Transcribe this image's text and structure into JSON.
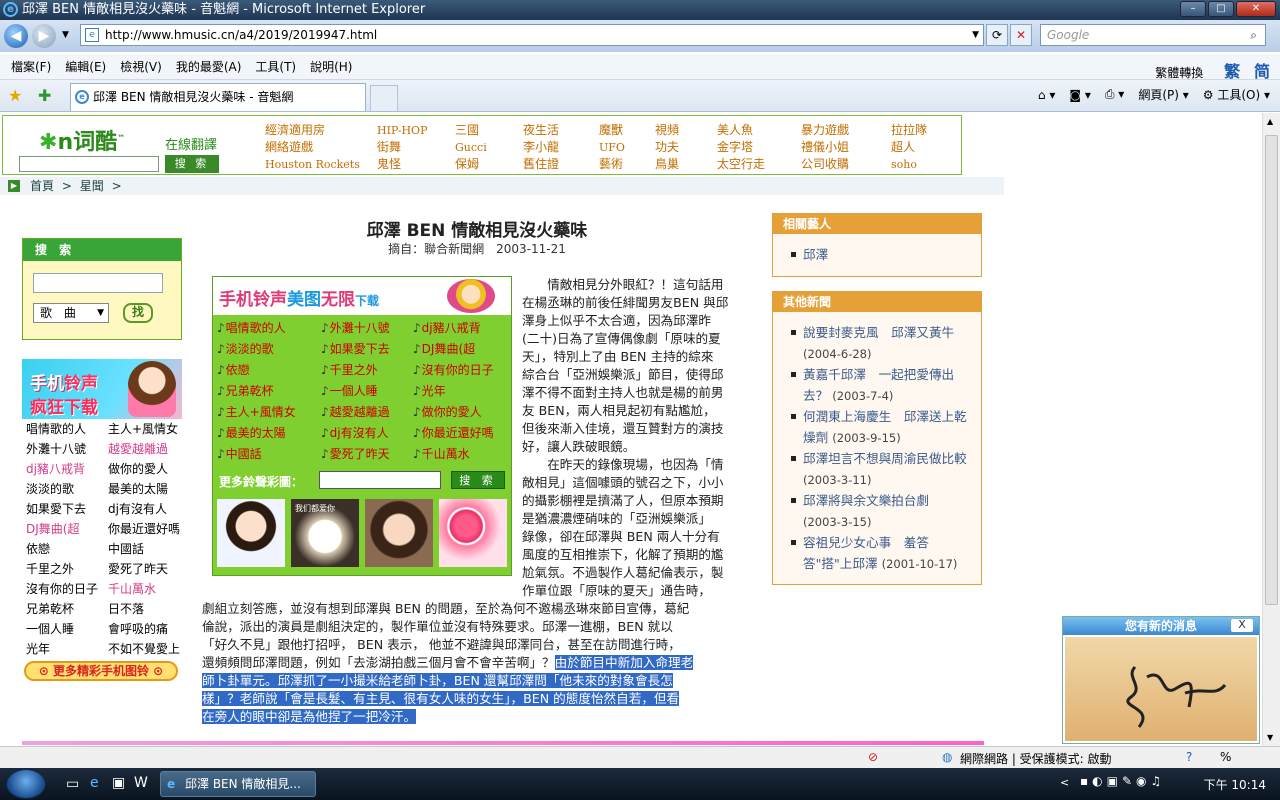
{
  "window": {
    "title": "邱澤 BEN 情敵相見沒火藥味 - 音魁網 - Microsoft Internet Explorer"
  },
  "browser": {
    "url": "http://www.hmusic.cn/a4/2019/2019947.html",
    "search_placeholder": "Google",
    "menu": [
      "檔案(F)",
      "編輯(E)",
      "檢視(V)",
      "我的最愛(A)",
      "工具(T)",
      "說明(H)"
    ],
    "lang_switch": "繁體轉換",
    "lang_trad": "繁",
    "lang_simp": "简",
    "tab_title": "邱澤 BEN 情敵相見沒火藥味 - 音魁網",
    "tools": {
      "page": "網頁(P)",
      "tools": "工具(O)"
    }
  },
  "topad": {
    "logo": "n词酷",
    "translate": "在線翻譯",
    "search_btn": "搜 索",
    "keywords": [
      [
        "經濟適用房",
        "網絡遊戲",
        "Houston Rockets"
      ],
      [
        "HIP-HOP",
        "街舞",
        "鬼怪"
      ],
      [
        "三國",
        "Gucci",
        "保姆"
      ],
      [
        "夜生活",
        "李小龍",
        "舊住證"
      ],
      [
        "魔獸",
        "UFO",
        "藝術"
      ],
      [
        "視頻",
        "功夫",
        "鳥巢"
      ],
      [
        "美人魚",
        "金字塔",
        "太空行走"
      ],
      [
        "暴力遊戲",
        "禮儀小姐",
        "公司收購"
      ],
      [
        "拉拉隊",
        "超人",
        "soho"
      ]
    ]
  },
  "breadcrumb": {
    "home": "首頁",
    "sep1": ">",
    "section": "星聞",
    "sep2": ">"
  },
  "left": {
    "search_title": "搜 索",
    "select_value": "歌 曲",
    "go_btn": "找",
    "banner_line1a": "手机",
    "banner_line1b": "铃声",
    "banner_line2": "疯狂下载",
    "rings_col1": [
      "唱情歌的人",
      "外灘十八號",
      "dj豬八戒背",
      "淡淡的歌",
      "如果愛下去",
      "DJ舞曲(超",
      "依戀",
      "千里之外",
      "沒有你的日子",
      "兄弟乾杯",
      "一個人睡",
      "光年"
    ],
    "rings_col2": [
      "主人+風情女",
      "越愛越離過",
      "做你的愛人",
      "最美的太陽",
      "dj有沒有人",
      "你最近還好嗎",
      "中國話",
      "愛死了昨天",
      "千山萬水",
      "日不落",
      "會呼吸的痛",
      "不如不覺愛上"
    ],
    "more": "更多精彩手机图铃"
  },
  "article": {
    "title": "邱澤 BEN 情敵相見沒火藥味",
    "source": "摘自：聯合新聞網　2003-11-21",
    "lines_right": [
      "　　情敵相見分外眼紅？！這句話用",
      "在楊丞琳的前後任緋聞男友BEN 與邱",
      "澤身上似乎不太合適，因為邱澤昨",
      "(二十)日為了宣傳偶像劇「原味的夏",
      "天」，特別上了由 BEN 主持的綜來",
      "綜合台「亞洲娛樂派」節目，使得邱",
      "澤不得不面對主持人也就是楊的前男",
      "友 BEN，兩人相見起初有點尷尬，",
      "但後來漸入佳境，還互贊對方的演技",
      "好，讓人跌破眼鏡。",
      "　　在昨天的錄像現場，也因為「情",
      "敵相見」這個噱頭的號召之下，小小",
      "的攝影棚裡是擠滿了人，但原本預期",
      "是猶濃濃煙硝味的「亞洲娛樂派」",
      "錄像，卻在邱澤與 BEN 兩人十分有",
      "風度的互相推崇下，化解了預期的尷",
      "尬氣氛。不過製作人葛紀倫表示，製",
      "作單位跟「原味的夏天」通告時，"
    ],
    "lines_full": [
      "劇組立刻答應，並沒有想到邱澤與 BEN 的問題，至於為何不邀楊丞琳來節目宣傳，葛紀",
      "倫說，派出的演員是劇組決定的，製作單位並沒有特殊要求。邱澤一進棚，BEN 就以",
      "「好久不見」跟他打招呼， BEN 表示， 他並不避諱與邱澤同台，甚至在訪問進行時，",
      "還頻頻問邱澤問題，例如「去澎湖拍戲三個月會不會辛苦啊」？"
    ],
    "hl_first": "由於節目中新加入命理老",
    "hl_lines": [
      "師卜卦單元。邱澤抓了一小撮米給老師卜卦，BEN 還幫邱澤問「他未來的對象會長怎",
      "樣」？老師說「會是長髮、有主見、很有女人味的女生」，BEN 的態度怡然自若，但看",
      "在旁人的眼中卻是為他捏了一把冷汗。"
    ]
  },
  "ad": {
    "banner_a": "手机铃声",
    "banner_b": "美图",
    "banner_c": "无限",
    "banner_d": "下载",
    "rings": [
      [
        "唱情歌的人",
        "外灘十八號",
        "dj豬八戒背"
      ],
      [
        "淡淡的歌",
        "如果愛下去",
        "DJ舞曲(超"
      ],
      [
        "依戀",
        "千里之外",
        "沒有你的日子"
      ],
      [
        "兄弟乾杯",
        "一個人睡",
        "光年"
      ],
      [
        "主人+風情女",
        "越愛越離過",
        "做你的愛人"
      ],
      [
        "最美的太陽",
        "dj有沒有人",
        "你最近還好嗎"
      ],
      [
        "中國話",
        "愛死了昨天",
        "千山萬水"
      ]
    ],
    "more_label": "更多鈴聲彩圖：",
    "search_btn": "搜 索",
    "thumb2_text": "我们都爱你"
  },
  "right": {
    "related_title": "相關藝人",
    "related": [
      "邱澤"
    ],
    "news_title": "其他新聞",
    "news": [
      {
        "title": "說要封麥克風　邱澤又黃牛",
        "date": "(2004-6-28)"
      },
      {
        "title": "黃嘉千邱澤　一起把愛傳出去？",
        "date": "(2003-7-4)"
      },
      {
        "title": "何潤東上海慶生　邱澤送上乾燥劑",
        "date": "(2003-9-15)"
      },
      {
        "title": "邱澤坦言不想與周渝民做比較",
        "date": "(2003-3-11)"
      },
      {
        "title": "邱澤將與余文樂拍台劇",
        "date": "(2003-3-15)"
      },
      {
        "title": "容祖兒少女心事　羞答答\"搭\"上邱澤",
        "date": "(2001-10-17)"
      }
    ]
  },
  "popup": {
    "title": "您有新的消息",
    "close": "X"
  },
  "status": {
    "zone": "網際網路 | 受保護模式: 啟動",
    "zoom": "%"
  },
  "taskbar": {
    "task": "邱澤 BEN 情敵相見...",
    "time": "下午 10:14"
  }
}
